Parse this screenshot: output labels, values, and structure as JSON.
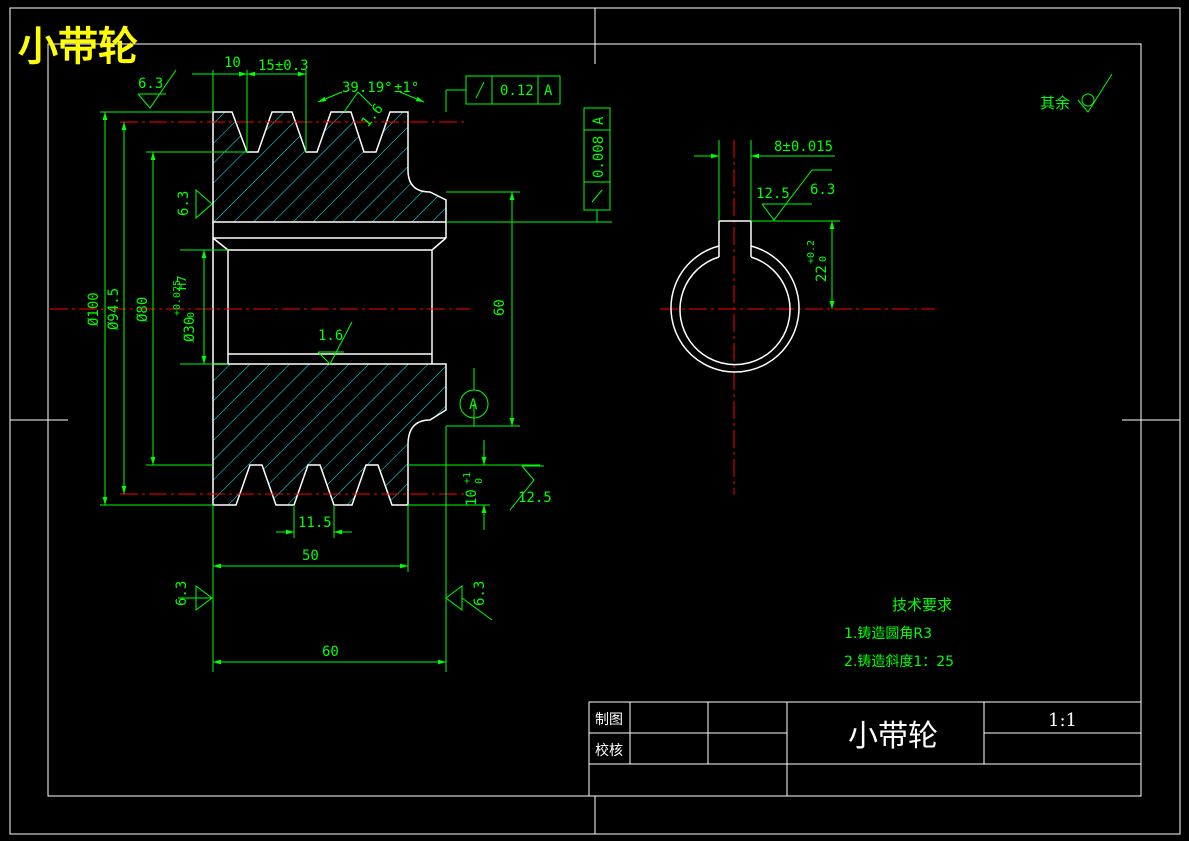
{
  "drawing": {
    "corner_title": "小带轮",
    "part_name": "小带轮",
    "scale": "1:1",
    "colors": {
      "background": "#000000",
      "frame": "#ffffff",
      "dimension": "#00ff00",
      "title": "#ffff00",
      "centerline": "#ff0000",
      "hatch": "#00ffff"
    }
  },
  "dims": {
    "width_10": "10",
    "groove_pitch": "15±0.3",
    "groove_angle": "39.19°",
    "angle_tol": "±1°",
    "top_rough": "6.3",
    "groove_rough": "1.6",
    "runout": "0.12",
    "runout_datum": "A",
    "flat_tol": "0.008",
    "flat_datum": "A",
    "left_rough": "6.3",
    "d100": "Ø100",
    "d94": "Ø94.5",
    "d80": "Ø80",
    "bore": "Ø30",
    "bore_tol_up": "+0.025",
    "bore_tol_low": "0",
    "bore_fit": "H7",
    "bore_rough": "1.6",
    "hub_60": "60",
    "datum_a": "A",
    "groove_depth": "10",
    "groove_depth_tol_up": "+1",
    "groove_depth_tol_low": "0",
    "bottom_rough": "12.5",
    "groove_width": "11.5",
    "width_50": "50",
    "face_left_rough": "6.3",
    "face_right_rough": "6.3",
    "width_60": "60",
    "key_width": "8±0.015",
    "key_rough_a": "12.5",
    "key_rough_b": "6.3",
    "key_depth": "22",
    "key_depth_tol_up": "+0.2",
    "key_depth_tol_low": "0",
    "rest_label": "其余"
  },
  "notes": {
    "title": "技术要求",
    "items": [
      "1.铸造圆角R3",
      "2.铸造斜度1：25"
    ]
  },
  "title_block": {
    "drawn_label": "制图",
    "checked_label": "校核"
  }
}
